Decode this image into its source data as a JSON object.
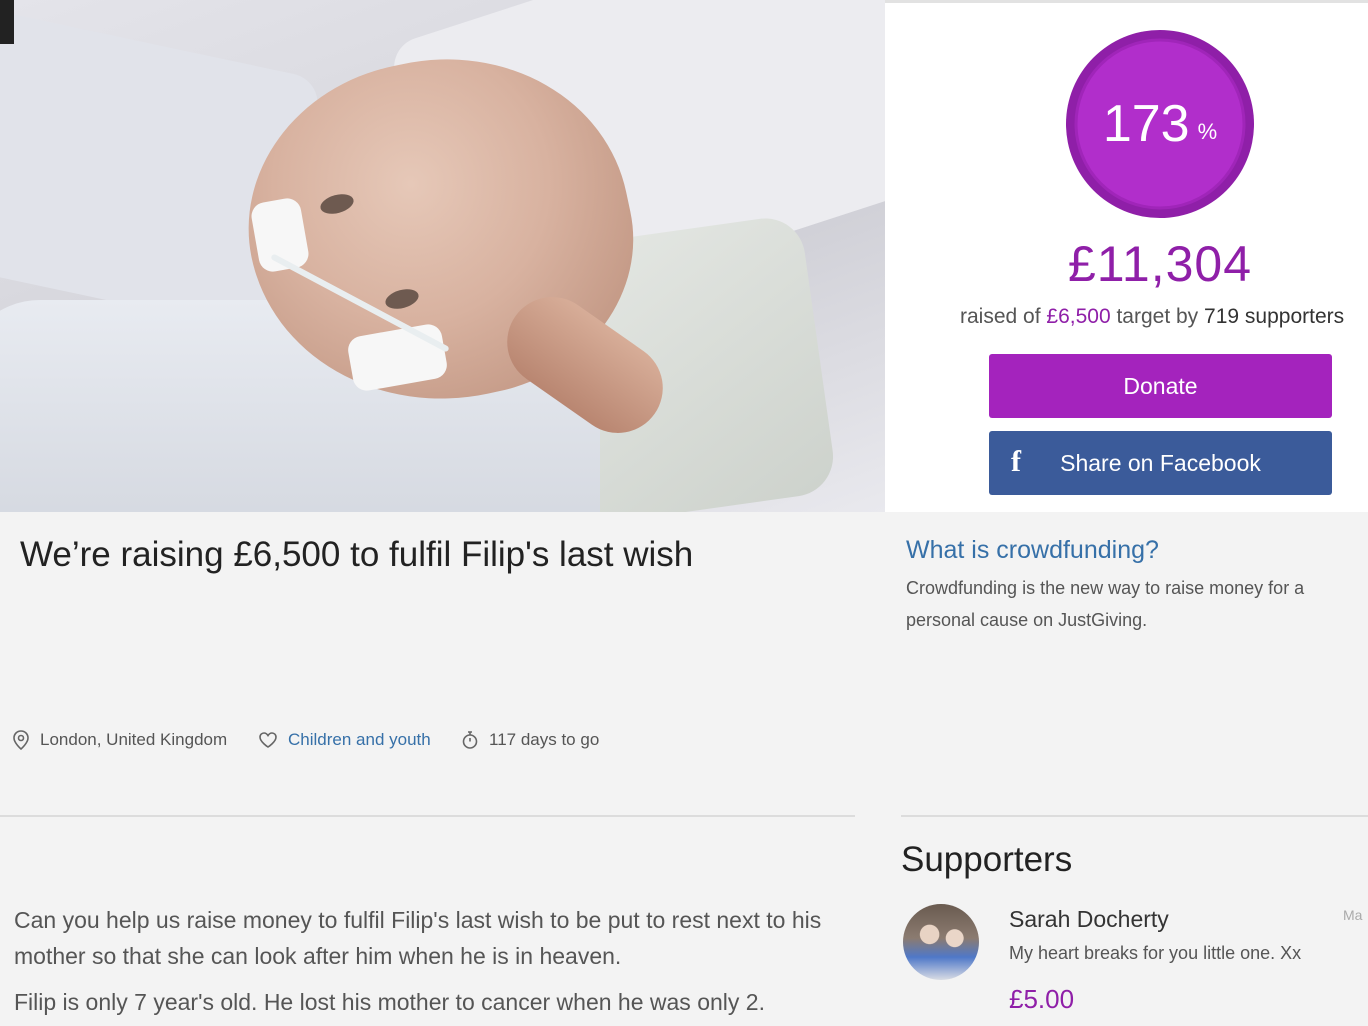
{
  "colors": {
    "brand": "#a423bd",
    "brand_text": "#8f1fa8",
    "facebook": "#3b5b9a",
    "link": "#3670a8"
  },
  "hero": {
    "image_icon": "photo-of-child-in-hospital-bed"
  },
  "progress": {
    "percent_value": "173",
    "percent_sign": "%",
    "fraction": 1.73
  },
  "funding": {
    "amount": "£11,304",
    "raised_prefix": "raised of",
    "target": "£6,500",
    "target_mid": "target by",
    "supporters": "719 supporters"
  },
  "buttons": {
    "donate": "Donate",
    "facebook": "Share on Facebook",
    "facebook_icon": "f"
  },
  "page_title": "We’re raising £6,500 to fulfil Filip's last wish",
  "crowdfunding": {
    "title": "What is crowdfunding?",
    "text": "Crowdfunding is the new way to raise money for a personal cause on JustGiving."
  },
  "meta": {
    "location": "London, United Kingdom",
    "category": "Children and youth",
    "days": "117 days to go"
  },
  "story": {
    "p1": "Can you help us raise money to fulfil Filip's last wish to be put to rest next to his mother so that she can look after him when he is in heaven.",
    "p2": "Filip is only 7 year's old. He lost his mother to cancer when he was only 2."
  },
  "supporters": {
    "title": "Supporters",
    "items": [
      {
        "name": "Sarah Docherty",
        "message": "My heart breaks for you little one. Xx",
        "amount": "£5.00",
        "date": "Ma"
      }
    ]
  }
}
